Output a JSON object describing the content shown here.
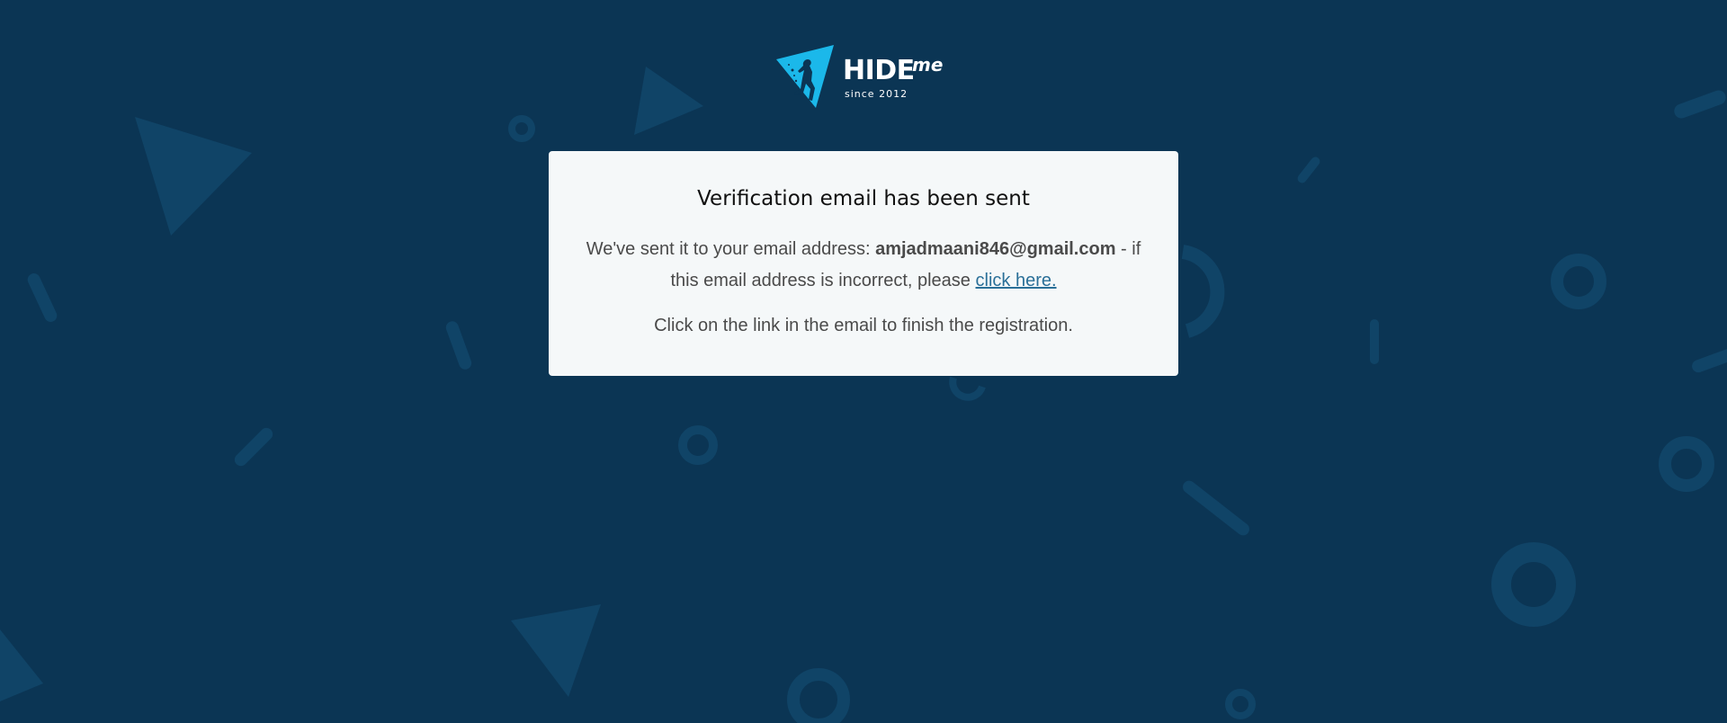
{
  "colors": {
    "background": "#0b3554",
    "card": "#f5f8f9",
    "logo_accent": "#1bb8ea",
    "link": "#2a6f98"
  },
  "logo": {
    "brand": "HIDE",
    "suffix": "me",
    "tagline": "since 2012",
    "icon": "triangle-runner-icon"
  },
  "card": {
    "title": "Verification email has been sent",
    "line1_prefix": "We've sent it to your email address: ",
    "email": "amjadmaani846@gmail.com",
    "line1_suffix": " - if this email address is incorrect, please ",
    "link_text": "click here.",
    "note": "Click on the link in the email to finish the registration."
  }
}
